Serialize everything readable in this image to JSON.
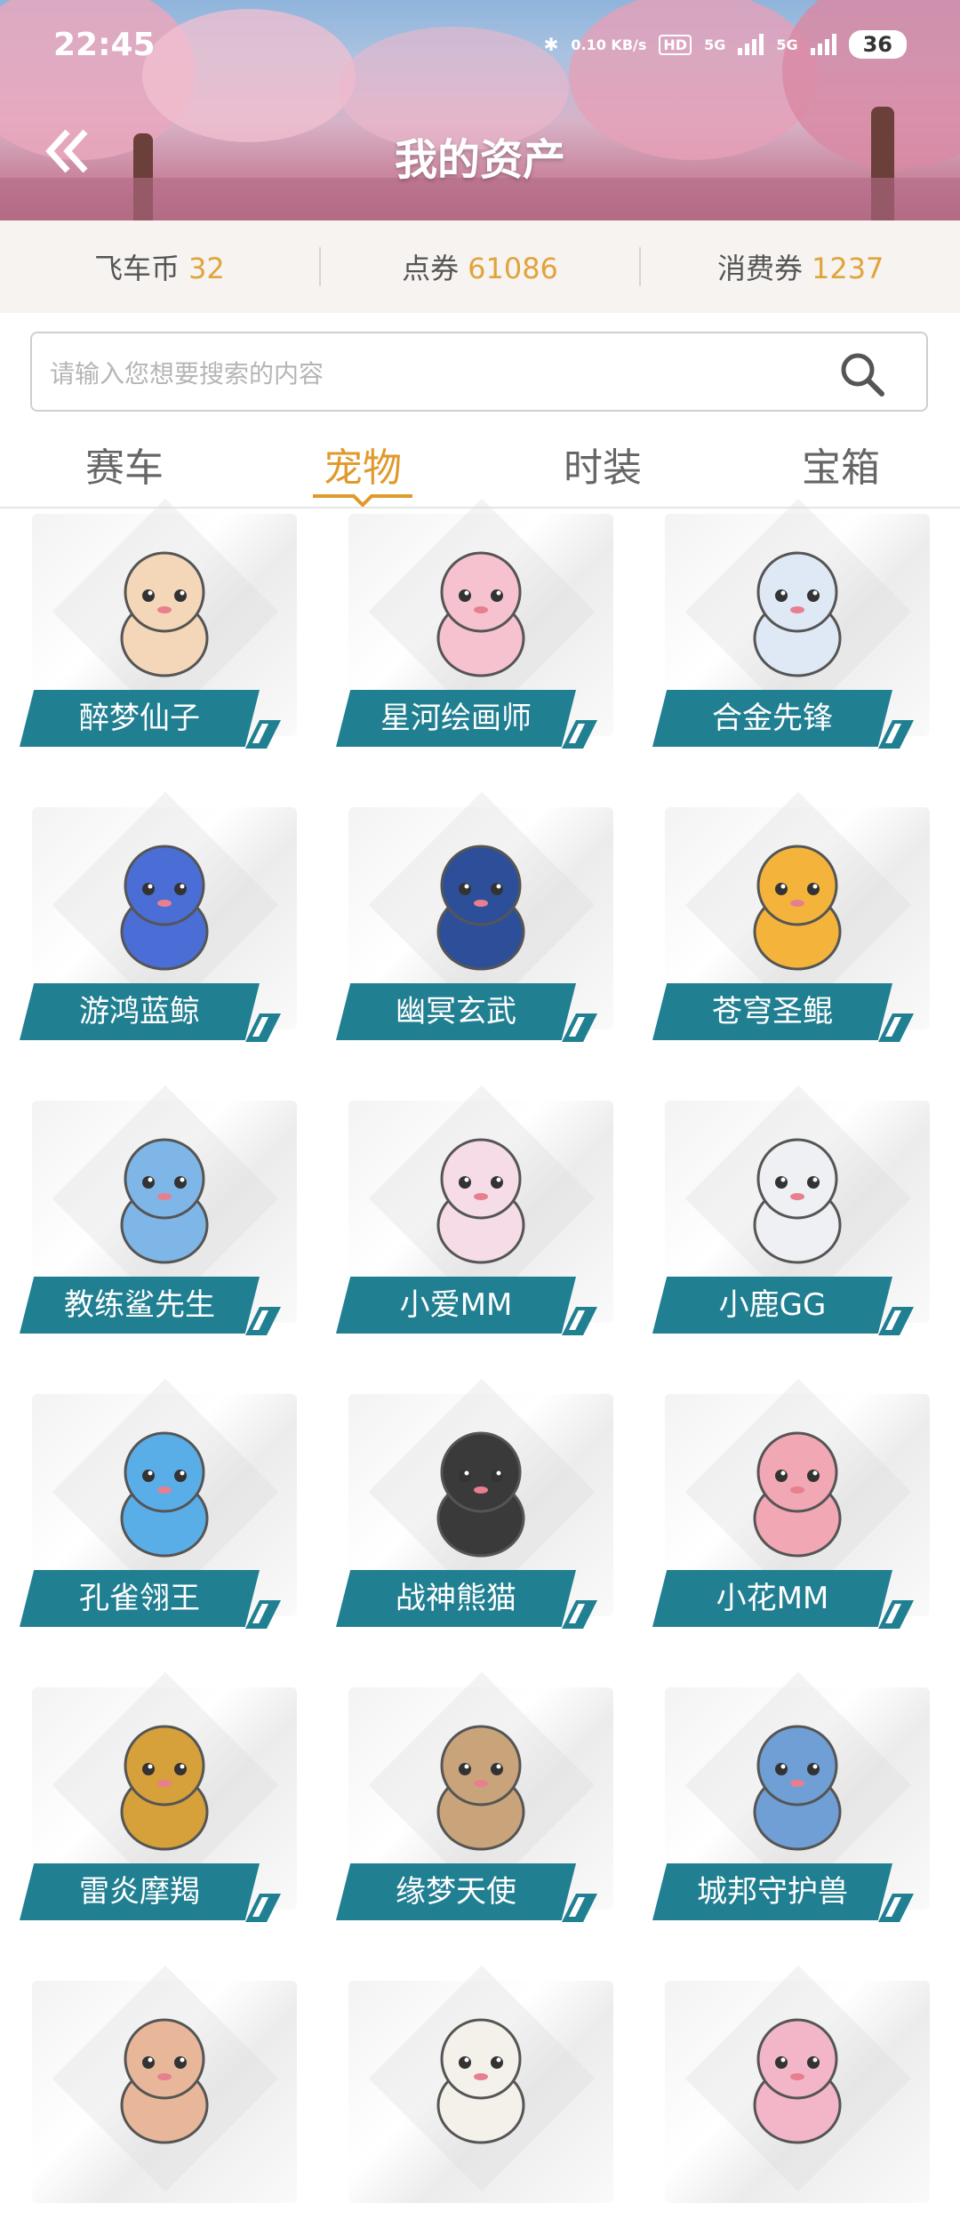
{
  "status_bar": {
    "time": "22:45",
    "net_speed": "0.10 KB/s",
    "hd": "HD",
    "sig1": "5G",
    "sig2": "5G",
    "battery": "36"
  },
  "header": {
    "title": "我的资产",
    "back_icon": "double-chevron-left-icon"
  },
  "currency": [
    {
      "label": "飞车币",
      "value": "32"
    },
    {
      "label": "点券",
      "value": "61086"
    },
    {
      "label": "消费券",
      "value": "1237"
    }
  ],
  "search": {
    "placeholder": "请输入您想要搜索的内容",
    "icon": "search-icon"
  },
  "tabs": [
    {
      "label": "赛车",
      "active": false
    },
    {
      "label": "宠物",
      "active": true
    },
    {
      "label": "时装",
      "active": false
    },
    {
      "label": "宝箱",
      "active": false
    }
  ],
  "pets": [
    {
      "name": "醉梦仙子",
      "icon": "pet-fairy-icon",
      "color": "#f4d7b8"
    },
    {
      "name": "星河绘画师",
      "icon": "pet-painter-icon",
      "color": "#f6c2cf"
    },
    {
      "name": "合金先锋",
      "icon": "pet-alloy-icon",
      "color": "#dfe9f6"
    },
    {
      "name": "游鸿蓝鲸",
      "icon": "pet-whale-icon",
      "color": "#4a6ed6"
    },
    {
      "name": "幽冥玄武",
      "icon": "pet-robot-icon",
      "color": "#2d4f9a"
    },
    {
      "name": "苍穹圣鲲",
      "icon": "pet-fish-icon",
      "color": "#f4b43c"
    },
    {
      "name": "教练鲨先生",
      "icon": "pet-shark-icon",
      "color": "#7fb6e8"
    },
    {
      "name": "小爱MM",
      "icon": "pet-bear-girl-icon",
      "color": "#f6dce6"
    },
    {
      "name": "小鹿GG",
      "icon": "pet-bear-boy-icon",
      "color": "#eef0f4"
    },
    {
      "name": "孔雀翎王",
      "icon": "pet-peacock-icon",
      "color": "#5aaee8"
    },
    {
      "name": "战神熊猫",
      "icon": "pet-panda-icon",
      "color": "#3a3a3a"
    },
    {
      "name": "小花MM",
      "icon": "pet-girl-icon",
      "color": "#f2a7b4"
    },
    {
      "name": "雷炎摩羯",
      "icon": "pet-warrior-icon",
      "color": "#d6a03a"
    },
    {
      "name": "缘梦天使",
      "icon": "pet-angel-icon",
      "color": "#c9a47a"
    },
    {
      "name": "城邦守护兽",
      "icon": "pet-dragon-icon",
      "color": "#6f9fd4"
    },
    {
      "name": "",
      "icon": "pet-doll-icon",
      "color": "#e8b79a"
    },
    {
      "name": "",
      "icon": "pet-sheep-icon",
      "color": "#f4f1ea"
    },
    {
      "name": "",
      "icon": "pet-pink-girl-icon",
      "color": "#f3b6c8"
    }
  ]
}
